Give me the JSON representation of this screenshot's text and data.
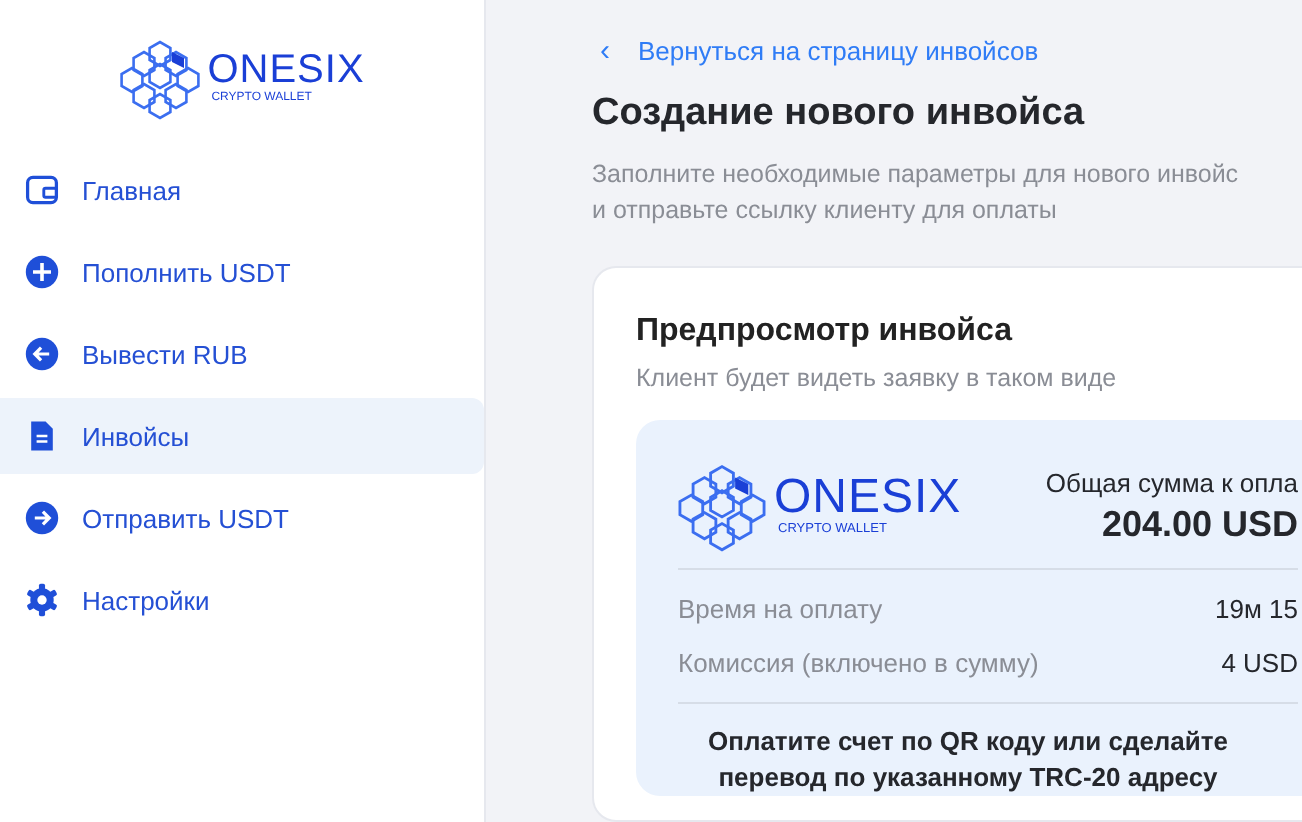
{
  "sidebar": {
    "logo": {
      "name": "ONESIX",
      "tagline": "CRYPTO WALLET"
    },
    "items": [
      {
        "kind": "wallet",
        "label": "Главная",
        "selected": false
      },
      {
        "kind": "plus",
        "label": "Пополнить USDT",
        "selected": false
      },
      {
        "kind": "arrow-left",
        "label": "Вывести RUB",
        "selected": false
      },
      {
        "kind": "document",
        "label": "Инвойсы",
        "selected": true
      },
      {
        "kind": "arrow-right",
        "label": "Отправить USDT",
        "selected": false
      },
      {
        "kind": "gear",
        "label": "Настройки",
        "selected": false
      }
    ]
  },
  "main": {
    "back_link": {
      "icon": "‹",
      "label": "Вернуться на страницу инвойсов"
    },
    "title": "Создание нового инвойса",
    "subtitle": [
      "Заполните необходимые параметры для нового инвойс",
      "и отправьте ссылку клиенту для оплаты"
    ],
    "preview_card": {
      "title": "Предпросмотр инвойса",
      "subtitle": "Клиент будет видеть заявку в таком виде",
      "invoice": {
        "logo": {
          "name": "ONESIX",
          "tagline": "CRYPTO WALLET"
        },
        "total_label": "Общая сумма к опла",
        "total": "204.00 USD",
        "rows": [
          {
            "label": "Время на оплату",
            "value": "19м 15"
          },
          {
            "label": "Комиссия (включено в сумму)",
            "value": "4 USD"
          }
        ],
        "instructions": [
          "Оплатите счет по QR коду или сделайте",
          "перевод по указанному TRC-20 адресу"
        ]
      }
    }
  }
}
